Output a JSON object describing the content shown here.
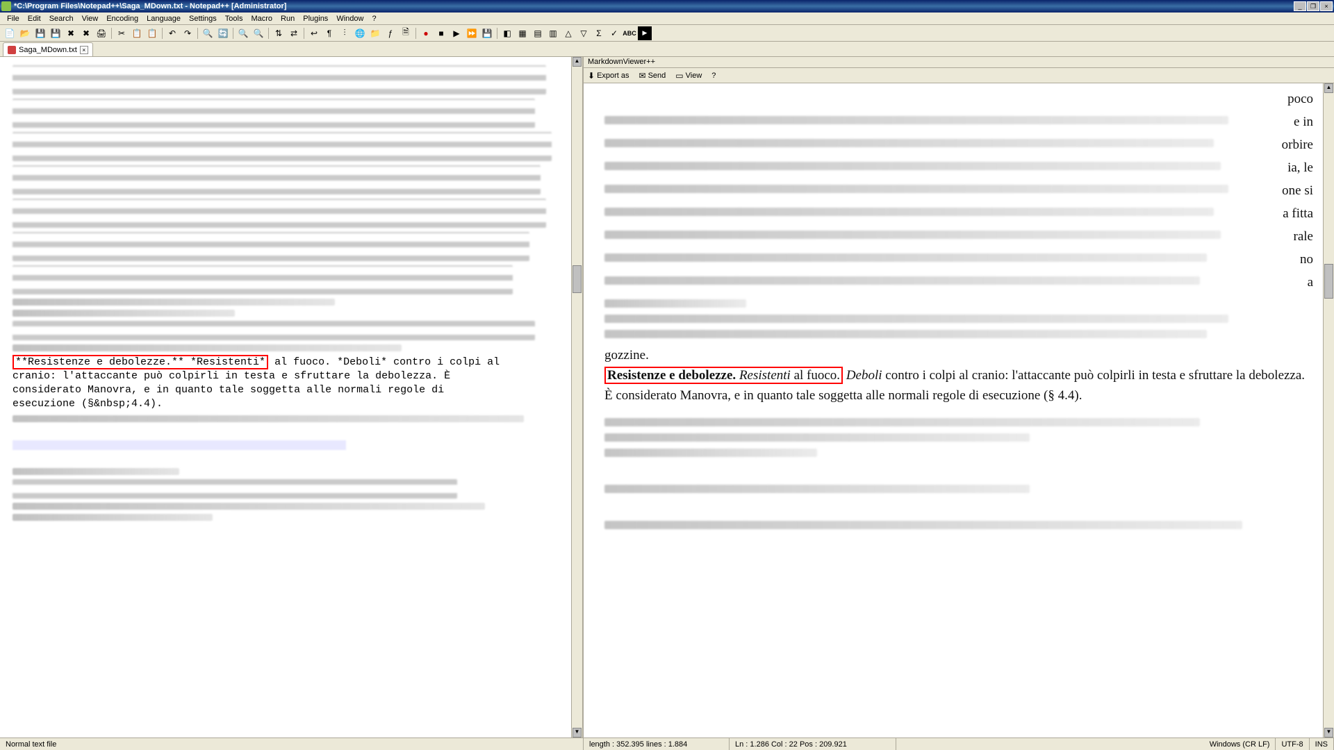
{
  "title": "*C:\\Program Files\\Notepad++\\Saga_MDown.txt - Notepad++ [Administrator]",
  "menu": [
    "File",
    "Edit",
    "Search",
    "View",
    "Encoding",
    "Language",
    "Settings",
    "Tools",
    "Macro",
    "Run",
    "Plugins",
    "Window",
    "?"
  ],
  "tab": {
    "label": "Saga_MDown.txt",
    "close": "×"
  },
  "editor": {
    "highlighted_src": "**Resistenze e debolezze.** *Resistenti*",
    "rest_line1": " al fuoco. *Deboli* contro i colpi al",
    "line2": "cranio: l'attaccante può colpirli in testa e sfruttare la debolezza. È",
    "line3": "considerato Manovra, e in quanto tale soggetta alle normali regole di",
    "line4": "esecuzione (§&nbsp;4.4)."
  },
  "preview": {
    "panel_title": "MarkdownViewer++",
    "toolbar": {
      "export": "Export as",
      "send": "Send",
      "view": "View",
      "help": "?"
    },
    "frag_right": [
      "poco",
      "e in",
      "orbire",
      "ia, le",
      "one si",
      "a fitta",
      "rale",
      "no",
      "a"
    ],
    "frag_left": "gozzine.",
    "bold": "Resistenze e debolezze.",
    "italic1": "Resistenti",
    "text1_after": " al fuoco.",
    "italic2": "Deboli",
    "text2": " contro i colpi al cranio: l'attaccante può colpirli in testa e sfruttare la debolezza. È considerato Manovra, e in quanto tale soggetta alle normali regole di esecuzione (§ 4.4)."
  },
  "status": {
    "left": "Normal text file",
    "length": "length : 352.395    lines : 1.884",
    "pos": "Ln : 1.286    Col : 22    Pos : 209.921",
    "eol": "Windows (CR LF)",
    "enc": "UTF-8",
    "ins": "INS"
  },
  "winbtns": {
    "min": "_",
    "max": "❐",
    "close": "×"
  }
}
